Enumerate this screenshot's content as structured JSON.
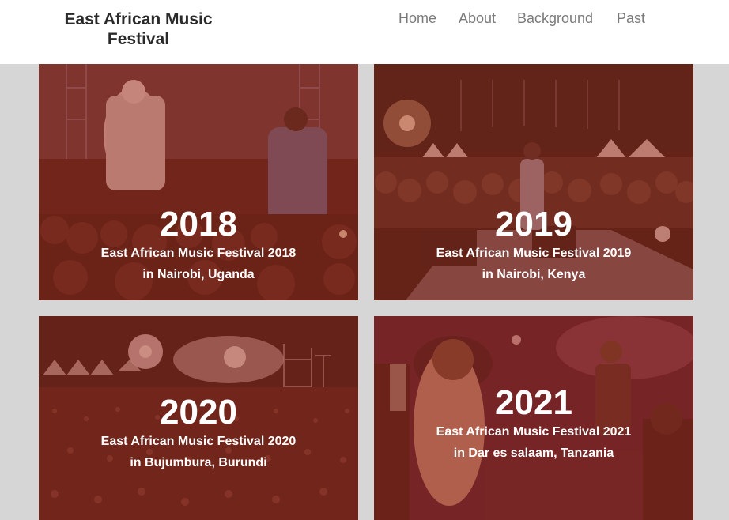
{
  "navbar": {
    "brand": "East African Music Festival",
    "links": [
      "Home",
      "About",
      "Background",
      "Past"
    ]
  },
  "cards": [
    {
      "year": "2018",
      "description": "East African Music Festival 2018 in Nairobi, Uganda",
      "image": "concert-stage-performers-photo"
    },
    {
      "year": "2019",
      "description": "East African Music Festival 2019 in Nairobi, Kenya",
      "image": "night-crowd-stage-photo"
    },
    {
      "year": "2020",
      "description": "East African Music Festival 2020 in Bujumbura, Burundi",
      "image": "festival-lights-crowd-photo"
    },
    {
      "year": "2021",
      "description": "East African Music Festival 2021 in Dar es salaam, Tanzania",
      "image": "performers-closeup-photo"
    }
  ],
  "colors": {
    "overlay": "#a0301c",
    "page_bg": "#d6d6d6",
    "nav_text": "#7a7a7a",
    "brand_text": "#2a2a2a"
  }
}
